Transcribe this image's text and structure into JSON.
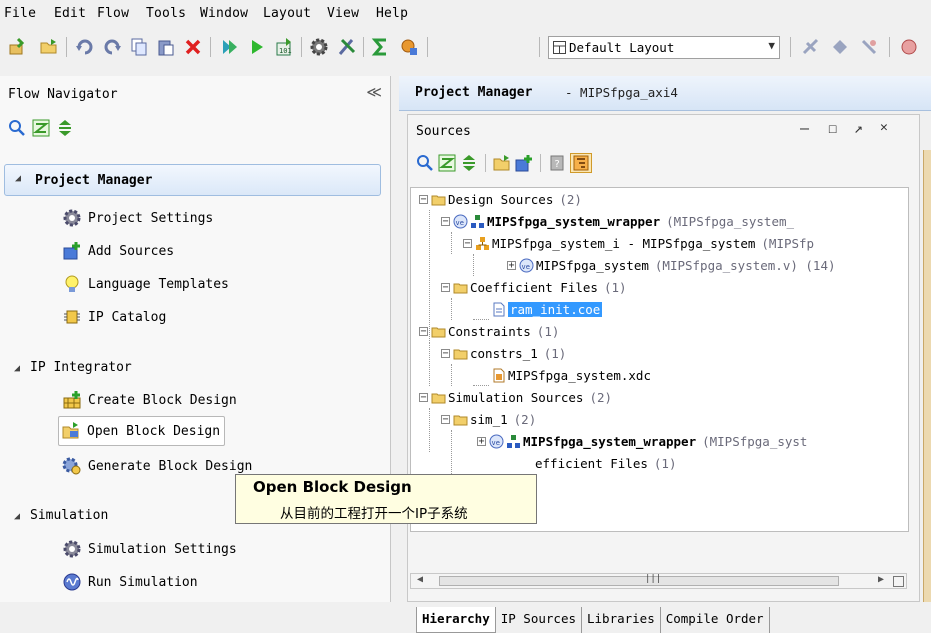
{
  "menu": [
    "File",
    "Edit",
    "Flow",
    "Tools",
    "Window",
    "Layout",
    "View",
    "Help"
  ],
  "toolbar": {
    "icons": [
      "new-project-icon",
      "open-project-icon",
      "undo-icon",
      "redo-icon",
      "copy-icon",
      "paste-icon",
      "delete-icon",
      "run-icon",
      "run-synthesis-icon",
      "generate-bitstream-icon",
      "settings-icon",
      "cut-tool-icon",
      "sigma-icon",
      "report-icon"
    ],
    "layout_value": "Default Layout"
  },
  "flow_navigator": {
    "title": "Flow Navigator",
    "collapse": "≪",
    "project_manager": {
      "title": "Project Manager",
      "items": [
        "Project Settings",
        "Add Sources",
        "Language Templates",
        "IP Catalog"
      ]
    },
    "ip_integrator": {
      "title": "IP Integrator",
      "items": [
        "Create Block Design",
        "Open Block Design",
        "Generate Block Design"
      ]
    },
    "simulation": {
      "title": "Simulation",
      "items": [
        "Simulation Settings",
        "Run Simulation"
      ]
    }
  },
  "project_manager": {
    "title": "Project Manager",
    "project_name": "- MIPSfpga_axi4"
  },
  "sources": {
    "title": "Sources",
    "window_controls": [
      "—",
      "☐",
      "↗",
      "✕"
    ],
    "tree": {
      "design_sources": {
        "label": "Design Sources",
        "count": "(2)"
      },
      "wrapper": {
        "label": "MIPSfpga_system_wrapper",
        "detail": "(MIPSfpga_system_"
      },
      "system_i": {
        "label": "MIPSfpga_system_i - MIPSfpga_system",
        "detail": "(MIPSfp"
      },
      "system": {
        "label": "MIPSfpga_system",
        "detail": "(MIPSfpga_system.v) (14)"
      },
      "coefficient_files": {
        "label": "Coefficient Files",
        "count": "(1)"
      },
      "ram_init": {
        "label": "ram_init.coe"
      },
      "constraints": {
        "label": "Constraints",
        "count": "(1)"
      },
      "constrs_1": {
        "label": "constrs_1",
        "count": "(1)"
      },
      "xdc": {
        "label": "MIPSfpga_system.xdc"
      },
      "simulation_sources": {
        "label": "Simulation Sources",
        "count": "(2)"
      },
      "sim_1": {
        "label": "sim_1",
        "count": "(2)"
      },
      "sim_wrapper": {
        "label": "MIPSfpga_system_wrapper",
        "detail": "(MIPSfpga_syst"
      },
      "sim_coefficient": {
        "label": "efficient Files",
        "count": "(1)"
      }
    },
    "tabs": [
      "Hierarchy",
      "IP Sources",
      "Libraries",
      "Compile Order"
    ]
  },
  "tooltip": {
    "title": "Open Block Design",
    "description": "从目前的工程打开一个IP子系统"
  }
}
